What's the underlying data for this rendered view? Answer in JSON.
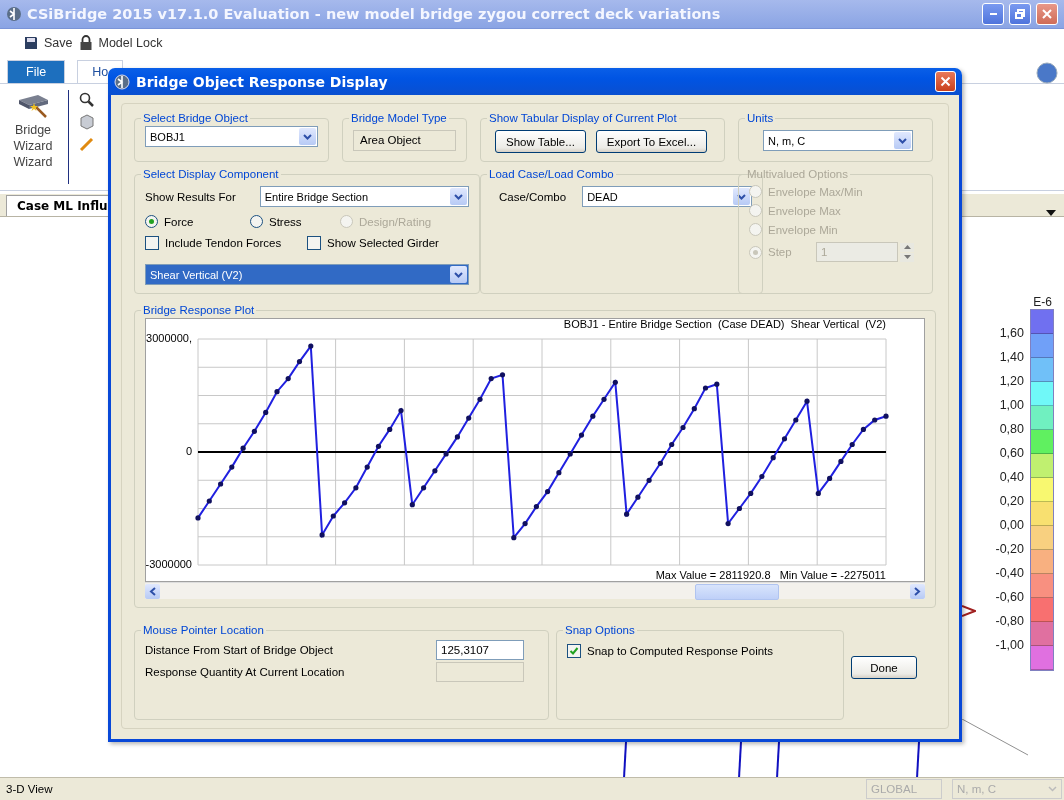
{
  "window": {
    "title": "CSiBridge 2015 v17.1.0 Evaluation  - new model bridge zygou correct deck variations"
  },
  "quick_access": [
    {
      "label": "Save"
    },
    {
      "label": "Model Lock"
    }
  ],
  "ribbon": {
    "tabs": [
      {
        "label": "File",
        "selected": false
      },
      {
        "label": "Ho",
        "selected": true
      }
    ],
    "button": "Bridge Wizard",
    "group_label": "Wizard"
  },
  "document_tabs": [
    {
      "label": "Case ML Influ"
    }
  ],
  "legend": {
    "exponent": "E-6",
    "labels": [
      "1,60",
      "1,40",
      "1,20",
      "1,00",
      "0,80",
      "0,60",
      "0,40",
      "0,20",
      "0,00",
      "-0,20",
      "-0,40",
      "-0,60",
      "-0,80",
      "-1,00"
    ],
    "bands": [
      {
        "color": "#7070f0"
      },
      {
        "color": "#70a0f8"
      },
      {
        "color": "#70c0f8"
      },
      {
        "color": "#70f8f8"
      },
      {
        "color": "#70f0c0"
      },
      {
        "color": "#60f060"
      },
      {
        "color": "#c0f070"
      },
      {
        "color": "#f8f870"
      },
      {
        "color": "#f8e070"
      },
      {
        "color": "#f8d080"
      },
      {
        "color": "#f8b080"
      },
      {
        "color": "#f89080"
      },
      {
        "color": "#f87070"
      },
      {
        "color": "#e070a0"
      },
      {
        "color": "#e070e0"
      }
    ]
  },
  "dialog": {
    "title": "Bridge Object Response Display",
    "bridge_object": {
      "label": "Select Bridge Object",
      "value": "BOBJ1"
    },
    "model_type": {
      "label": "Bridge Model Type",
      "value": "Area Object"
    },
    "tabular": {
      "label": "Show Tabular Display of Current Plot",
      "buttons": [
        "Show Table...",
        "Export To Excel..."
      ]
    },
    "units": {
      "label": "Units",
      "value": "N, m, C"
    },
    "display_component": {
      "label": "Select Display Component",
      "show_results_label": "Show Results For",
      "show_results_value": "Entire Bridge Section",
      "result_types": [
        {
          "label": "Force",
          "selected": true,
          "disabled": false
        },
        {
          "label": "Stress",
          "selected": false,
          "disabled": false
        },
        {
          "label": "Design/Rating",
          "selected": false,
          "disabled": true
        }
      ],
      "options": [
        {
          "label": "Include Tendon Forces",
          "checked": false
        },
        {
          "label": "Show Selected Girder",
          "checked": false
        }
      ],
      "component": {
        "value": "Shear Vertical  (V2)",
        "highlighted": true
      }
    },
    "load_case": {
      "label": "Load Case/Load Combo",
      "field_label": "Case/Combo",
      "value": "DEAD"
    },
    "multivalued": {
      "label": "Multivalued Options",
      "disabled": true,
      "options": [
        {
          "label": "Envelope Max/Min",
          "selected": false
        },
        {
          "label": "Envelope Max",
          "selected": false
        },
        {
          "label": "Envelope Min",
          "selected": false
        },
        {
          "label": "Step",
          "selected": true
        }
      ],
      "step_value": "1"
    },
    "plot": {
      "label": "Bridge Response Plot",
      "max_text": "Max Value = 2811920.8",
      "min_text": "Min Value = -2275011",
      "chart_data": {
        "type": "line",
        "title": "BOBJ1 - Entire Bridge Section  (Case DEAD)  Shear Vertical  (V2)",
        "ylim": [
          -3000000,
          3000000
        ],
        "yticks": [
          {
            "value": 3000000,
            "label": "3000000,"
          },
          {
            "value": 0,
            "label": "0"
          },
          {
            "value": -3000000,
            "label": "-3000000"
          }
        ],
        "categories": [
          null,
          null,
          null,
          null,
          null,
          null,
          null,
          null,
          null,
          null,
          null,
          null,
          null,
          null,
          null,
          null,
          null,
          null,
          null,
          null,
          null,
          null,
          null,
          null,
          null,
          null,
          null,
          null,
          null,
          null,
          null,
          null,
          null,
          null,
          null,
          null,
          null,
          null,
          null,
          null,
          null,
          null,
          null,
          null,
          null,
          null,
          null,
          null,
          null,
          null,
          null,
          null,
          null,
          null,
          null,
          null,
          null,
          null,
          null,
          null,
          null,
          null
        ],
        "series": [
          {
            "color": "#2020e0",
            "values": [
              -1750000,
              -1300000,
              -850000,
              -400000,
              100000,
              550000,
              1050000,
              1600000,
              1950000,
              2400000,
              2811920.8,
              -2200000,
              -1700000,
              -1350000,
              -950000,
              -400000,
              150000,
              600000,
              1100000,
              -1400000,
              -950000,
              -500000,
              -50000,
              400000,
              900000,
              1400000,
              1950000,
              2050000,
              -2275011,
              -1900000,
              -1450000,
              -1050000,
              -550000,
              -50000,
              450000,
              950000,
              1400000,
              1850000,
              -1650000,
              -1200000,
              -750000,
              -300000,
              200000,
              650000,
              1150000,
              1700000,
              1800000,
              -1900000,
              -1500000,
              -1100000,
              -650000,
              -150000,
              350000,
              850000,
              1350000,
              -1100000,
              -700000,
              -250000,
              200000,
              600000,
              850000,
              950000
            ]
          }
        ],
        "grid": true
      }
    },
    "pointer": {
      "label": "Mouse Pointer Location",
      "rows": [
        {
          "label": "Distance From Start of Bridge Object",
          "value": "125,3107",
          "disabled": false
        },
        {
          "label": "Response Quantity At Current Location",
          "disabled": true
        }
      ]
    },
    "snap": {
      "label": "Snap Options",
      "options": [
        {
          "label": "Snap to Computed Response Points",
          "checked": true
        }
      ]
    },
    "done_button": "Done"
  },
  "status_bar": {
    "view": "3-D View",
    "coord_system": "GLOBAL",
    "units": "N, m, C"
  }
}
